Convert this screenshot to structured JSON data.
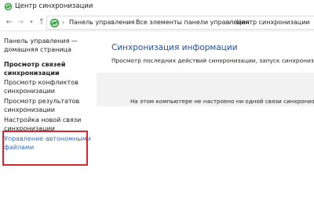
{
  "window": {
    "title": "Центр синхронизации",
    "icon": "sync-center-icon"
  },
  "navigation": {
    "back_icon": "arrow-left-icon",
    "forward_icon": "arrow-right-icon",
    "recent_icon": "chevron-down-icon",
    "up_icon": "arrow-up-icon",
    "separator": "›",
    "breadcrumbs": [
      "Панель управления",
      "Все элементы панели управления",
      "Центр синхронизации"
    ]
  },
  "sidebar": {
    "items": [
      "Панель управления —\nдомашняя страница",
      "Просмотр связей\nсинхронизации",
      "Просмотр конфликтов\nсинхронизации",
      "Просмотр результатов\nсинхронизации",
      "Настройка новой связи\nсинхронизации",
      "Управление автономными\nфайлами"
    ],
    "highlight_color": "#d9252c"
  },
  "main": {
    "title": "Синхронизация информации",
    "description": "Просмотр последних действий синхронизации, запуск синхронизации, ",
    "empty_message": "На этом компьютере не настроено ни одной связи синхронизации."
  },
  "colors": {
    "title_blue": "#1f4f9c",
    "link_blue": "#2a6cc4",
    "sync_green": "#3ea64b"
  }
}
